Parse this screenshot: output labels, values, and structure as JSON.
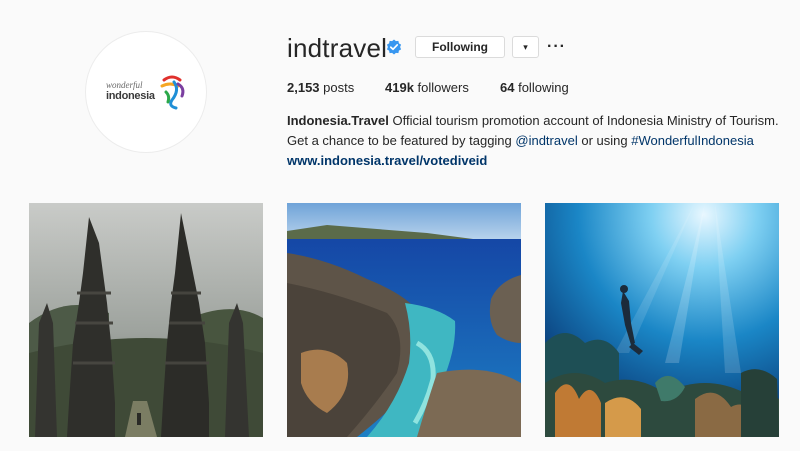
{
  "profile": {
    "username": "indtravel",
    "follow_label": "Following",
    "dropdown_glyph": "▾",
    "more_glyph": "···",
    "logo": {
      "line1": "wonderful",
      "line2": "indonesia"
    },
    "icons": [
      "verified-badge-icon",
      "chevron-down-icon",
      "more-options-icon"
    ],
    "accent_color": "#3897f0"
  },
  "stats": {
    "posts_count": "2,153",
    "posts_label": "posts",
    "followers_count": "419k",
    "followers_label": "followers",
    "following_count": "64",
    "following_label": "following"
  },
  "bio": {
    "name": "Indonesia.Travel",
    "line1_text": " Official tourism promotion account of Indonesia Ministry of Tourism.",
    "line2_pre": "Get a chance to be featured by tagging ",
    "mention": "@indtravel",
    "line2_mid": " or using ",
    "hashtag": "#WonderfulIndonesia",
    "website": "www.indonesia.travel/votediveid"
  },
  "posts": [
    {
      "subject": "split temple gate in misty mountains"
    },
    {
      "subject": "rocky coastline with turquoise sea"
    },
    {
      "subject": "freediver over coral reef in sunlight"
    }
  ]
}
